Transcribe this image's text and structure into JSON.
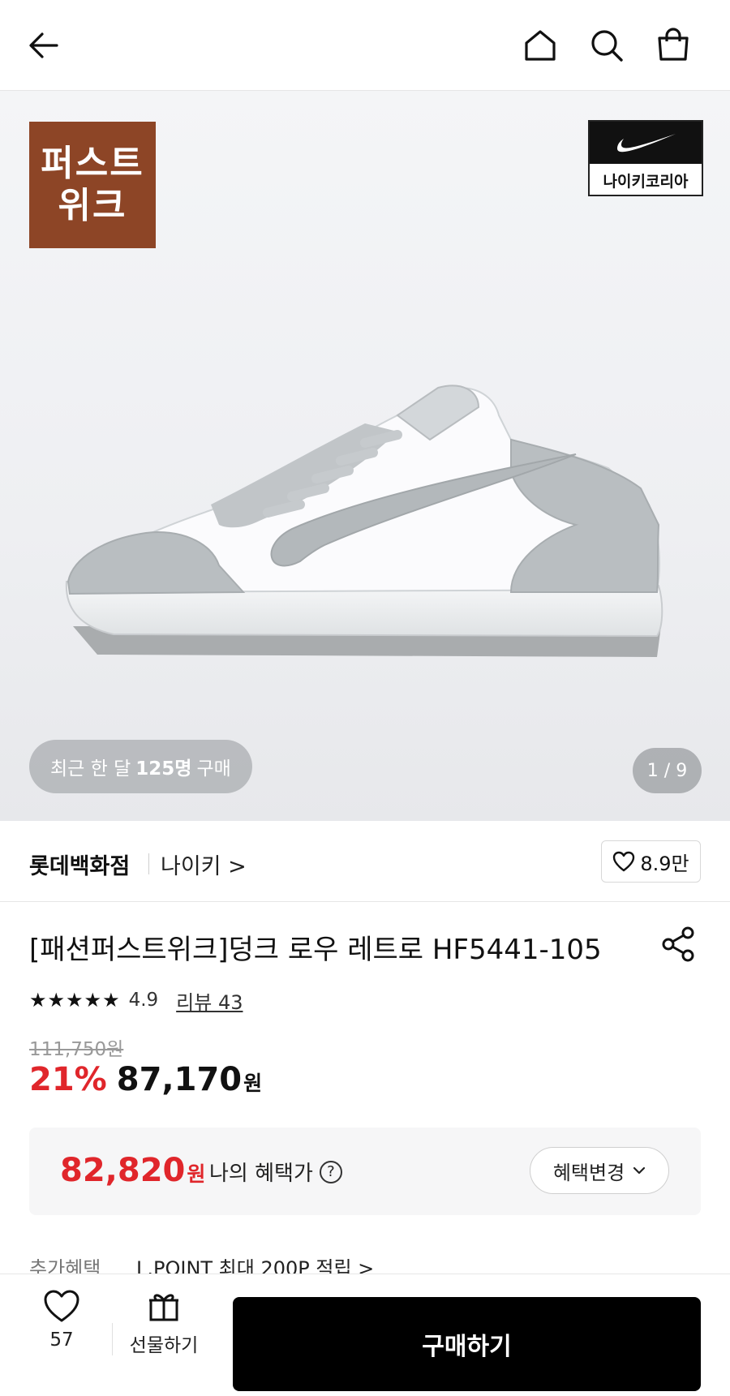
{
  "header": {
    "back_icon": "arrow-left-icon",
    "home_icon": "home-icon",
    "search_icon": "search-icon",
    "bag_icon": "shopping-bag-icon"
  },
  "hero": {
    "week_badge": "퍼스트\n위크",
    "brand_badge": "나이키코리아",
    "recent_prefix": "최근 한 달",
    "recent_count": "125명",
    "recent_suffix": "구매",
    "counter": "1 / 9"
  },
  "store": {
    "name": "롯데백화점",
    "brand": "나이키 >",
    "likes": "8.9만"
  },
  "product": {
    "title": "[패션퍼스트위크]덩크 로우 레트로 HF5441-105",
    "stars": "★★★★★",
    "rating": "4.9",
    "reviews": "리뷰 43",
    "original_price": "111,750원",
    "discount": "21%",
    "sale_price": "87,170",
    "currency": "원"
  },
  "benefit": {
    "price": "82,820",
    "currency": "원",
    "label": "나의 혜택가",
    "help": "?",
    "change": "혜택변경"
  },
  "extra": {
    "label": "추가혜택",
    "text": "L.POINT 최대 200P 적립 >"
  },
  "bottom": {
    "like_count": "57",
    "gift_label": "선물하기",
    "buy_label": "구매하기"
  },
  "colors": {
    "accent_red": "#e0262b",
    "badge_brown": "#8d4526",
    "buy_black": "#000000"
  }
}
